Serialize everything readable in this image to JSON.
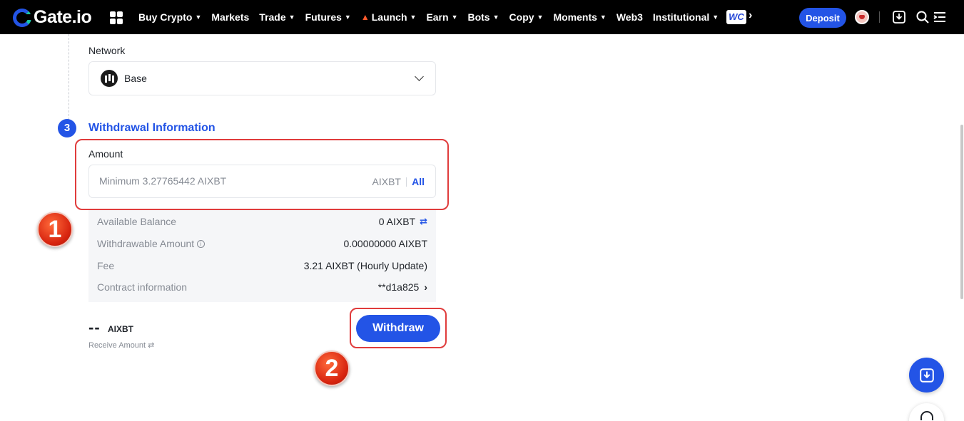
{
  "topbar": {
    "logo_text": "Gate.io",
    "nav": [
      {
        "label": "Buy Crypto",
        "caret": true
      },
      {
        "label": "Markets",
        "caret": false
      },
      {
        "label": "Trade",
        "caret": true
      },
      {
        "label": "Futures",
        "caret": true
      },
      {
        "label": "Launch",
        "caret": true
      },
      {
        "label": "Earn",
        "caret": true
      },
      {
        "label": "Bots",
        "caret": true
      },
      {
        "label": "Copy",
        "caret": true
      },
      {
        "label": "Moments",
        "caret": true
      },
      {
        "label": "Web3",
        "caret": false
      },
      {
        "label": "Institutional",
        "caret": true
      }
    ],
    "web3_badge": "WC",
    "more": "›",
    "deposit_label": "Deposit",
    "icons": [
      "apps-icon",
      "avatar",
      "download-icon",
      "search-icon",
      "menu-icon"
    ]
  },
  "network": {
    "label": "Network",
    "value": "Base"
  },
  "step": {
    "number": "3",
    "title": "Withdrawal Information"
  },
  "amount": {
    "label": "Amount",
    "placeholder": "Minimum 3.27765442 AIXBT",
    "unit": "AIXBT",
    "all_label": "All"
  },
  "info": {
    "available_balance_label": "Available Balance",
    "available_balance_value": "0 AIXBT",
    "withdrawable_label": "Withdrawable Amount",
    "withdrawable_value": "0.00000000 AIXBT",
    "fee_label": "Fee",
    "fee_value": "3.21 AIXBT (Hourly Update)",
    "contract_label": "Contract information",
    "contract_value": "**d1a825"
  },
  "receive": {
    "value": "--",
    "unit": "AIXBT",
    "label": "Receive Amount"
  },
  "withdraw_label": "Withdraw",
  "annotations": {
    "badge_1": "1",
    "badge_2": "2",
    "color": "#e03c3c"
  },
  "colors": {
    "accent": "#2354e6",
    "topbar_bg": "#000000",
    "muted_text": "#868b94"
  }
}
